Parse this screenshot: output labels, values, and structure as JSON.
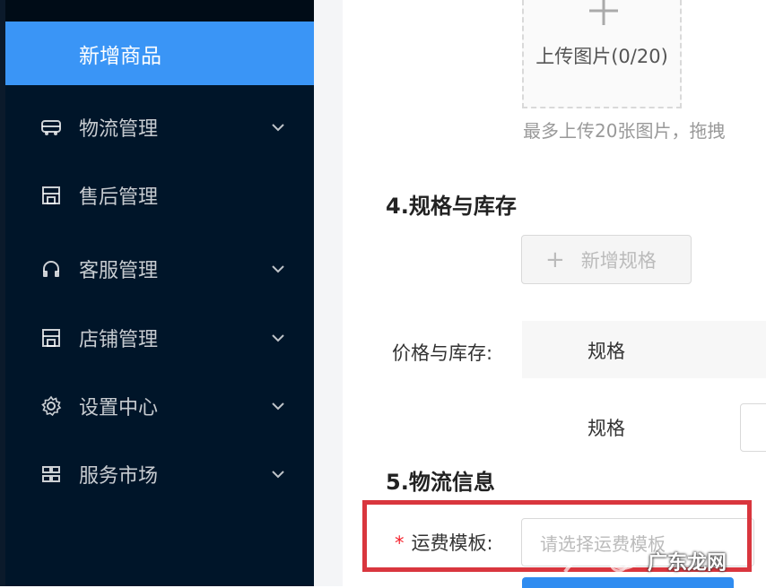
{
  "sidebar": {
    "active_item": "新增商品",
    "items": [
      {
        "label": "物流管理",
        "icon": "truck-icon",
        "has_submenu": true
      },
      {
        "label": "售后管理",
        "icon": "store-icon",
        "has_submenu": false
      },
      {
        "label": "客服管理",
        "icon": "headset-icon",
        "has_submenu": true
      },
      {
        "label": "店铺管理",
        "icon": "store-icon",
        "has_submenu": true
      },
      {
        "label": "设置中心",
        "icon": "gear-icon",
        "has_submenu": true
      },
      {
        "label": "服务市场",
        "icon": "grid-icon",
        "has_submenu": true
      }
    ],
    "bg_color": "#001529",
    "active_color": "#3a95f6"
  },
  "upload": {
    "label": "上传图片(0/20)",
    "hint": "最多上传20张图片，拖拽"
  },
  "spec_section": {
    "title": "4.规格与库存",
    "add_button": "新增规格",
    "price_stock_label": "价格与库存:",
    "column_header": "规格",
    "row_label": "规格"
  },
  "logistics_section": {
    "title": "5.物流信息",
    "freight_label": "运费模板:",
    "required_mark": "*",
    "freight_placeholder": "请选择运费模板"
  },
  "watermark": {
    "text": "广东龙网"
  },
  "colors": {
    "highlight": "#d9363e",
    "required": "#f5222d",
    "primary": "#2f8cf0"
  }
}
